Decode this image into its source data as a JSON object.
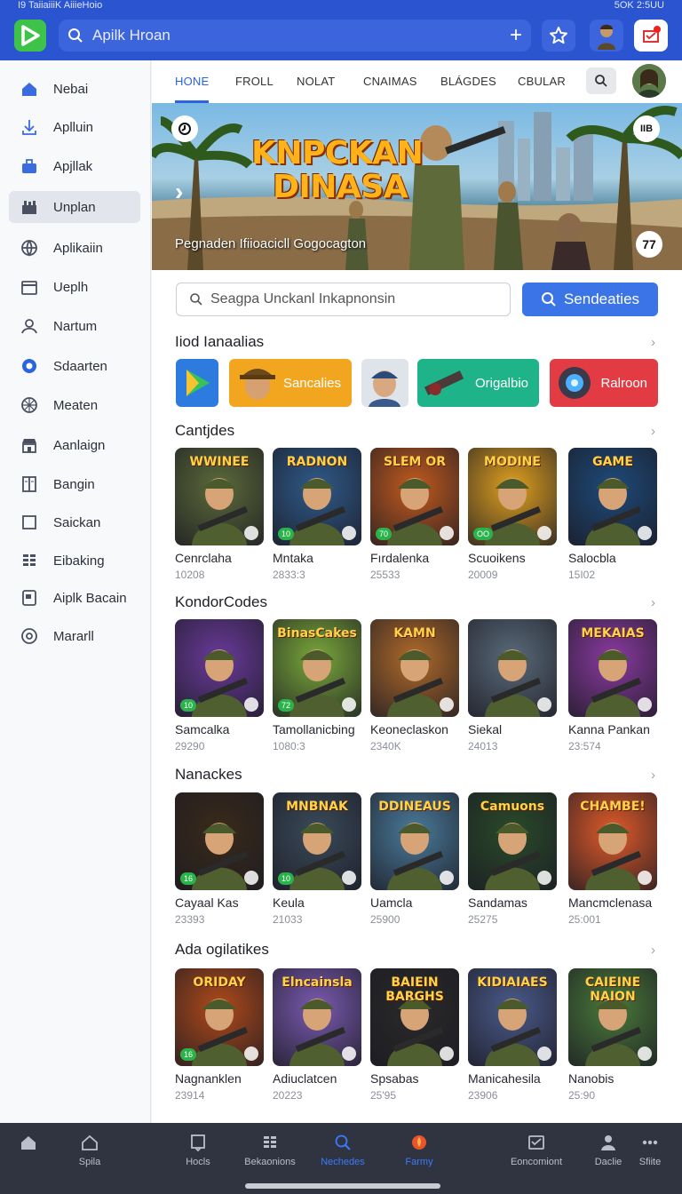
{
  "status": {
    "left": "I9 TaiiaiiiK AiiieHoio",
    "right": "5OK  2:5UU"
  },
  "header": {
    "search_placeholder": "Apilk Hroan"
  },
  "sidebar": {
    "items": [
      {
        "label": "Nebai",
        "icon": "home-icon"
      },
      {
        "label": "Aplluin",
        "icon": "download-icon"
      },
      {
        "label": "Apjllak",
        "icon": "briefcase-icon"
      },
      {
        "label": "Unplan",
        "icon": "library-icon",
        "active": true
      },
      {
        "label": "Aplikaiin",
        "icon": "globe-icon"
      },
      {
        "label": "Ueplh",
        "icon": "folder-icon"
      },
      {
        "label": "Nartum",
        "icon": "user-icon"
      },
      {
        "label": "Sdaarten",
        "icon": "radio-icon",
        "accent": true
      },
      {
        "label": "Meaten",
        "icon": "aperture-icon"
      },
      {
        "label": "Aanlaign",
        "icon": "store-icon"
      },
      {
        "label": "Bangin",
        "icon": "book-icon"
      },
      {
        "label": "Saickan",
        "icon": "square-icon"
      },
      {
        "label": "Eibaking",
        "icon": "grid-icon"
      },
      {
        "label": "Aiplk Bacain",
        "icon": "tablet-icon"
      },
      {
        "label": "Mararll",
        "icon": "at-icon"
      }
    ]
  },
  "tabs": [
    {
      "label": "HONE",
      "active": true
    },
    {
      "label": "FROLL"
    },
    {
      "label": "NOLAT"
    },
    {
      "label": "CNAIMAS"
    },
    {
      "label": "BLÁGDES"
    },
    {
      "label": "CBULAR"
    }
  ],
  "banner": {
    "title_line1": "KNPCKAN",
    "title_line2": "DINASA",
    "subtitle": "Pegnaden Ifiioacicll Gogocagton",
    "top_right": "IIB",
    "bottom_right": "77"
  },
  "search": {
    "placeholder": "Seagpa Unckanl Inkapnonsin",
    "button_label": "Sendeaties"
  },
  "categories": {
    "title": "Iiod Ianaalias",
    "items": [
      {
        "label": "",
        "color": "#2e7be0",
        "icon": "play-store-icon"
      },
      {
        "label": "Sancalies",
        "color": "#f2a51f",
        "icon": "soldier-icon"
      },
      {
        "label": "",
        "color": "#dfe3ea",
        "icon": "character-icon"
      },
      {
        "label": "Origalbio",
        "color": "#1fb38a",
        "icon": "weapon-icon"
      },
      {
        "label": "Ralroon",
        "color": "#e23b44",
        "icon": "gear-icon"
      }
    ]
  },
  "sections": [
    {
      "title": "Cantjdes",
      "games": [
        {
          "name": "Cenrclaha",
          "count": "10208",
          "banner": "WWINEE",
          "bg": "#5c6a3a",
          "badge": ""
        },
        {
          "name": "Mntaka",
          "count": "2833:3",
          "banner": "RADNON",
          "bg": "#2f5a8a",
          "badge": "10"
        },
        {
          "name": "Fırdalenka",
          "count": "25533",
          "banner": "SLEM OR",
          "bg": "#c25a1e",
          "badge": "70"
        },
        {
          "name": "Scuoikens",
          "count": "20009",
          "banner": "MODINE",
          "bg": "#e0a020",
          "badge": "OO"
        },
        {
          "name": "Salocbla",
          "count": "15I02",
          "banner": "GAME",
          "bg": "#1e4a7a",
          "badge": ""
        }
      ]
    },
    {
      "title": "KondorCodes",
      "games": [
        {
          "name": "Samcalka",
          "count": "29290",
          "banner": "",
          "bg": "#6a3a9a",
          "badge": "10"
        },
        {
          "name": "Tamollanicbing",
          "count": "1080:3",
          "banner": "BinasCakes",
          "bg": "#7aa83a",
          "badge": "72"
        },
        {
          "name": "Keoneclaskon",
          "count": "2340K",
          "banner": "KAMN",
          "bg": "#b06a2a",
          "badge": ""
        },
        {
          "name": "Siekal",
          "count": "24013",
          "banner": "",
          "bg": "#5a6a7a",
          "badge": ""
        },
        {
          "name": "Kanna Pankan",
          "count": "23:574",
          "banner": "MEKAIAS",
          "bg": "#8a3aa0",
          "badge": ""
        }
      ]
    },
    {
      "title": "Nanackes",
      "games": [
        {
          "name": "Cayaal Kas",
          "count": "23393",
          "banner": "",
          "bg": "#3a2a1a",
          "badge": "16"
        },
        {
          "name": "Keula",
          "count": "21033",
          "banner": "MNBNAK",
          "bg": "#3a4a5a",
          "badge": "10"
        },
        {
          "name": "Uamcla",
          "count": "25900",
          "banner": "DDINEAUS",
          "bg": "#4a7a9a",
          "badge": ""
        },
        {
          "name": "Sandamas",
          "count": "25275",
          "banner": "Camuons",
          "bg": "#2a4a2a",
          "badge": ""
        },
        {
          "name": "Mancmclenasa",
          "count": "25:001",
          "banner": "CHAMBE!",
          "bg": "#e05a2a",
          "badge": ""
        }
      ]
    },
    {
      "title": "Ada ogilatikes",
      "games": [
        {
          "name": "Nagnanklen",
          "count": "23914",
          "banner": "ORIDAY",
          "bg": "#b04a1a",
          "badge": "16"
        },
        {
          "name": "Adiuclatcen",
          "count": "20223",
          "banner": "Elncainsla",
          "bg": "#7a5ab0",
          "badge": ""
        },
        {
          "name": "Spsabas",
          "count": "25'95",
          "banner": "BAIEIN BARGHS",
          "bg": "#2a2a2a",
          "badge": ""
        },
        {
          "name": "Manicahesila",
          "count": "23906",
          "banner": "KIDIAIAES",
          "bg": "#4a5a8a",
          "badge": ""
        },
        {
          "name": "Nanobis",
          "count": "25:90",
          "banner": "CAIEINE NAION",
          "bg": "#4a7a3a",
          "badge": ""
        }
      ]
    }
  ],
  "bottom_nav": [
    {
      "label": "",
      "icon": "home-icon"
    },
    {
      "label": "Spila",
      "icon": "house-outline-icon"
    },
    {
      "label": "Hocls",
      "icon": "bookmark-icon"
    },
    {
      "label": "Bekaonions",
      "icon": "grid-icon"
    },
    {
      "label": "Nechedes",
      "icon": "search-icon",
      "active": true
    },
    {
      "label": "Farmy",
      "icon": "fire-icon",
      "active": true
    },
    {
      "label": "Eoncomiont",
      "icon": "inbox-icon"
    },
    {
      "label": "Daclie",
      "icon": "person-icon"
    },
    {
      "label": "Sfiite",
      "icon": "more-icon"
    }
  ]
}
